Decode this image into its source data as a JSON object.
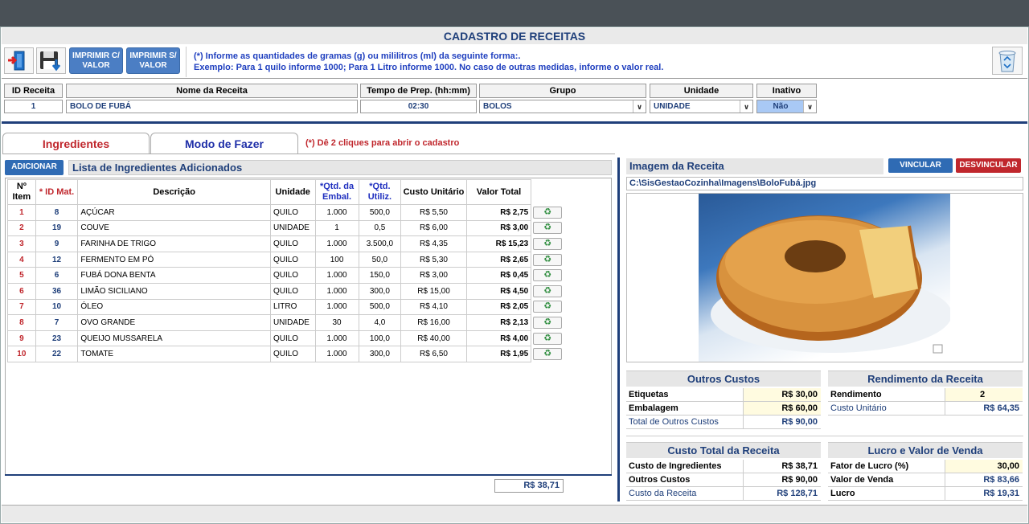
{
  "window": {
    "title": "CADASTRO DE RECEITAS"
  },
  "toolbar": {
    "exit_icon": "exit-door-icon",
    "save_icon": "save-disk-icon",
    "print_with_value": "IMPRIMIR C/ VALOR",
    "print_without_value": "IMPRIMIR S/ VALOR",
    "info_line1": "(*) Informe as quantidades de gramas (g) ou mililitros (ml) da seguinte forma:.",
    "info_line2": "Exemplo: Para 1 quilo informe 1000; Para 1 Litro informe 1000. No caso de outras medidas, informe o valor real.",
    "recycle_icon": "recycle-bin-icon"
  },
  "form": {
    "labels": {
      "id": "ID Receita",
      "name": "Nome da Receita",
      "prep_time": "Tempo de Prep. (hh:mm)",
      "group": "Grupo",
      "unit": "Unidade",
      "inactive": "Inativo"
    },
    "values": {
      "id": "1",
      "name": "BOLO DE FUBÁ",
      "prep_time": "02:30",
      "group": "BOLOS",
      "unit": "UNIDADE",
      "inactive": "Não"
    }
  },
  "tabs": {
    "ingredients": "Ingredientes",
    "method": "Modo de Fazer",
    "hint": "(*) Dê 2 cliques para abrir o cadastro"
  },
  "ingredients": {
    "add_button": "ADICIONAR",
    "list_title": "Lista de Ingredientes Adicionados",
    "headers": {
      "item": "Nº Item",
      "id_mat": "* ID Mat.",
      "description": "Descrição",
      "unit": "Unidade",
      "qty_pack": "*Qtd. da Embal.",
      "qty_used": "*Qtd. Utiliz.",
      "unit_cost": "Custo Unitário",
      "total": "Valor Total"
    },
    "rows": [
      {
        "item": "1",
        "id": "8",
        "desc": "AÇÚCAR",
        "unit": "QUILO",
        "pack": "1.000",
        "used": "500,0",
        "cost": "R$ 5,50",
        "total": "R$ 2,75"
      },
      {
        "item": "2",
        "id": "19",
        "desc": "COUVE",
        "unit": "UNIDADE",
        "pack": "1",
        "used": "0,5",
        "cost": "R$ 6,00",
        "total": "R$ 3,00"
      },
      {
        "item": "3",
        "id": "9",
        "desc": "FARINHA DE TRIGO",
        "unit": "QUILO",
        "pack": "1.000",
        "used": "3.500,0",
        "cost": "R$ 4,35",
        "total": "R$ 15,23"
      },
      {
        "item": "4",
        "id": "12",
        "desc": "FERMENTO EM PÓ",
        "unit": "QUILO",
        "pack": "100",
        "used": "50,0",
        "cost": "R$ 5,30",
        "total": "R$ 2,65"
      },
      {
        "item": "5",
        "id": "6",
        "desc": "FUBÁ DONA BENTA",
        "unit": "QUILO",
        "pack": "1.000",
        "used": "150,0",
        "cost": "R$ 3,00",
        "total": "R$ 0,45"
      },
      {
        "item": "6",
        "id": "36",
        "desc": "LIMÃO SICILIANO",
        "unit": "QUILO",
        "pack": "1.000",
        "used": "300,0",
        "cost": "R$ 15,00",
        "total": "R$ 4,50"
      },
      {
        "item": "7",
        "id": "10",
        "desc": "ÓLEO",
        "unit": "LITRO",
        "pack": "1.000",
        "used": "500,0",
        "cost": "R$ 4,10",
        "total": "R$ 2,05"
      },
      {
        "item": "8",
        "id": "7",
        "desc": "OVO GRANDE",
        "unit": "UNIDADE",
        "pack": "30",
        "used": "4,0",
        "cost": "R$ 16,00",
        "total": "R$ 2,13"
      },
      {
        "item": "9",
        "id": "23",
        "desc": "QUEIJO MUSSARELA",
        "unit": "QUILO",
        "pack": "1.000",
        "used": "100,0",
        "cost": "R$ 40,00",
        "total": "R$ 4,00"
      },
      {
        "item": "10",
        "id": "22",
        "desc": "TOMATE",
        "unit": "QUILO",
        "pack": "1.000",
        "used": "300,0",
        "cost": "R$ 6,50",
        "total": "R$ 1,95"
      }
    ],
    "grand_total": "R$ 38,71"
  },
  "image_panel": {
    "title": "Imagem da Receita",
    "link_button": "VINCULAR",
    "unlink_button": "DESVINCULAR",
    "path": "C:\\SisGestaoCozinha\\Imagens\\BoloFubá.jpg"
  },
  "other_costs": {
    "title": "Outros Custos",
    "labels": "Etiquetas",
    "labels_value": "R$ 30,00",
    "packaging": "Embalagem",
    "packaging_value": "R$ 60,00",
    "total": "Total de Outros Custos",
    "total_value": "R$ 90,00"
  },
  "yield": {
    "title": "Rendimento da Receita",
    "yield_label": "Rendimento",
    "yield_value": "2",
    "unit_cost_label": "Custo Unitário",
    "unit_cost_value": "R$ 64,35"
  },
  "total_cost": {
    "title": "Custo Total da Receita",
    "ingredients": "Custo de Ingredientes",
    "ingredients_value": "R$ 38,71",
    "others": "Outros Custos",
    "others_value": "R$ 90,00",
    "recipe": "Custo da Receita",
    "recipe_value": "R$ 128,71"
  },
  "profit": {
    "title": "Lucro e Valor de Venda",
    "factor": "Fator de Lucro (%)",
    "factor_value": "30,00",
    "sale": "Valor de Venda",
    "sale_value": "R$ 83,66",
    "profit": "Lucro",
    "profit_value": "R$ 19,31"
  }
}
